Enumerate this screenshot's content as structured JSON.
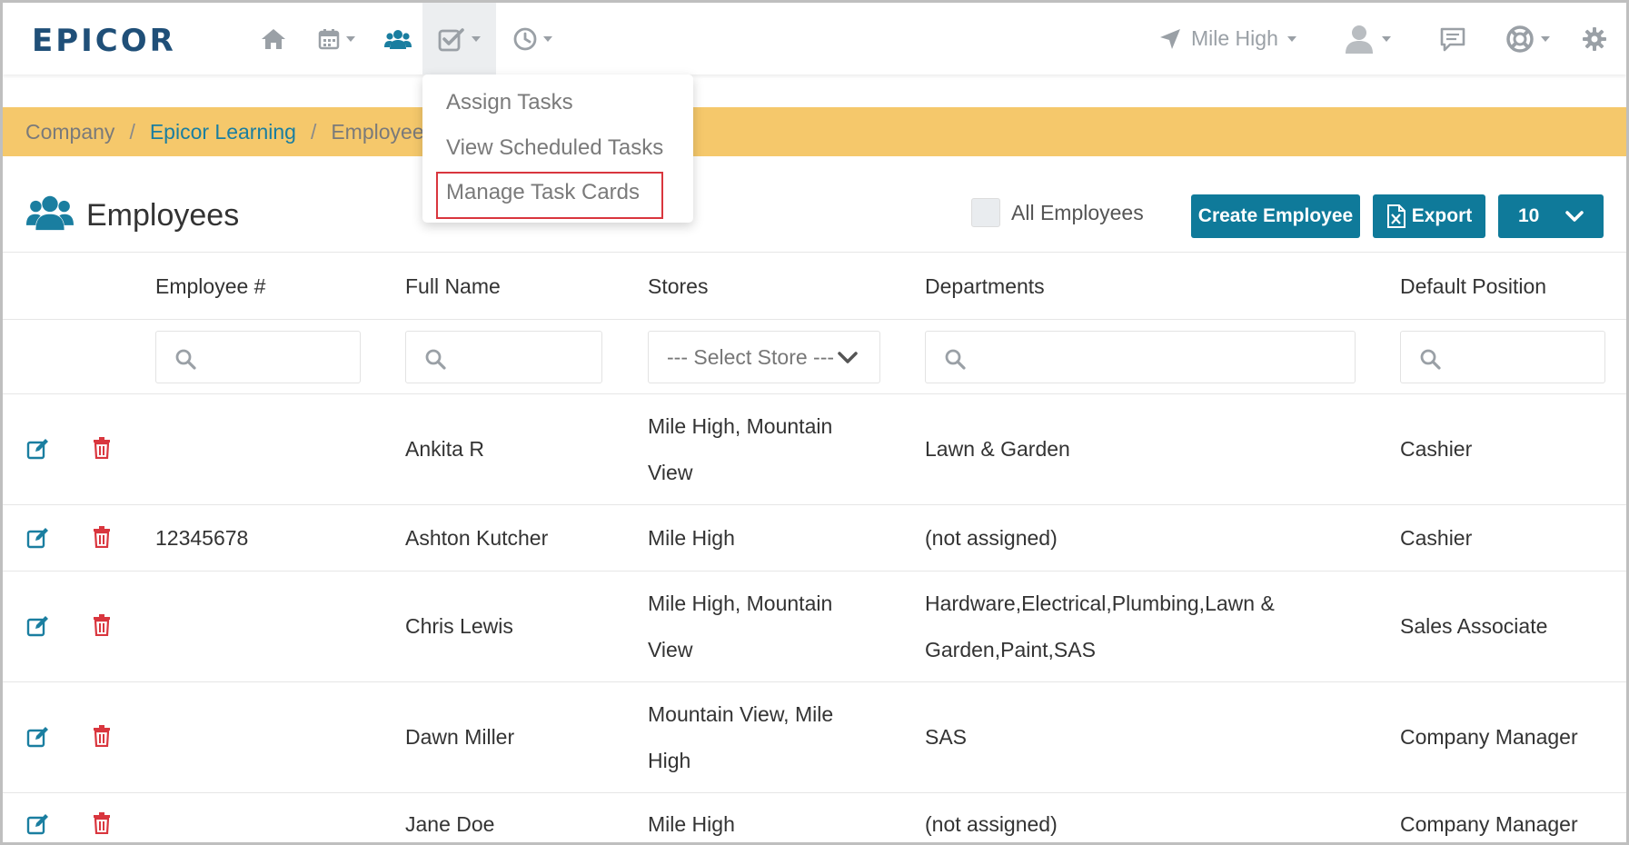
{
  "brand": {
    "logo_text": "EPICOR"
  },
  "topnav": {
    "store_label": "Mile High",
    "icons": [
      "home-icon",
      "calendar-icon",
      "users-icon",
      "tasks-icon",
      "clock-icon",
      "location-arrow-icon",
      "user-icon",
      "chat-icon",
      "help-lifebuoy-icon",
      "gear-icon"
    ]
  },
  "breadcrumb": {
    "items": [
      "Company",
      "Epicor Learning",
      "Employees"
    ]
  },
  "tasks_menu": {
    "items": [
      "Assign Tasks",
      "View Scheduled Tasks",
      "Manage Task Cards"
    ],
    "highlighted": "Manage Task Cards"
  },
  "page": {
    "title": "Employees",
    "all_employees_label": "All Employees",
    "create_button": "Create Employee",
    "export_button": "Export",
    "page_size": "10"
  },
  "table": {
    "headers": {
      "employee_no": "Employee #",
      "full_name": "Full Name",
      "stores": "Stores",
      "departments": "Departments",
      "default_position": "Default Position"
    },
    "store_filter_placeholder": "--- Select Store ---",
    "rows": [
      {
        "employee_no": "",
        "full_name": "Ankita R",
        "stores_line1": "Mile High, Mountain",
        "stores_line2": "View",
        "departments_line1": "Lawn & Garden",
        "departments_line2": "",
        "position": "Cashier"
      },
      {
        "employee_no": "12345678",
        "full_name": "Ashton Kutcher",
        "stores_line1": "Mile High",
        "stores_line2": "",
        "departments_line1": "(not assigned)",
        "departments_line2": "",
        "position": "Cashier"
      },
      {
        "employee_no": "",
        "full_name": "Chris Lewis",
        "stores_line1": "Mile High, Mountain",
        "stores_line2": "View",
        "departments_line1": "Hardware,Electrical,Plumbing,Lawn &",
        "departments_line2": "Garden,Paint,SAS",
        "position": "Sales Associate"
      },
      {
        "employee_no": "",
        "full_name": "Dawn Miller",
        "stores_line1": "Mountain View, Mile",
        "stores_line2": "High",
        "departments_line1": "SAS",
        "departments_line2": "",
        "position": "Company Manager"
      },
      {
        "employee_no": "",
        "full_name": "Jane Doe",
        "stores_line1": "Mile High",
        "stores_line2": "",
        "departments_line1": "(not assigned)",
        "departments_line2": "",
        "position": "Company Manager"
      }
    ]
  },
  "colors": {
    "brand": "#1f4f78",
    "accent": "#0f7a9a",
    "breadcrumb_bg": "#f5c86b",
    "delete": "#d9363e",
    "highlight_border": "#d9363e"
  }
}
